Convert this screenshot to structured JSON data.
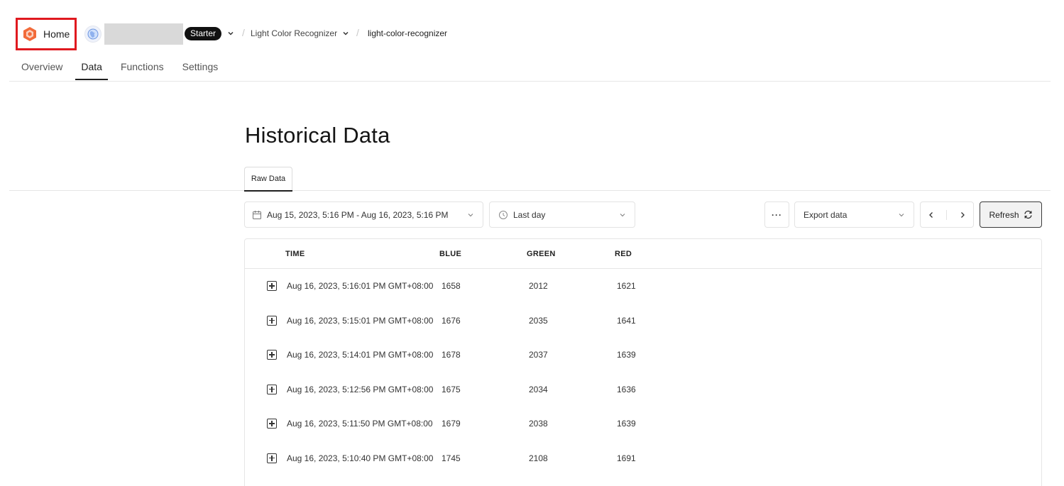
{
  "header": {
    "home_label": "Home",
    "plan_badge": "Starter",
    "app_name": "Light Color Recognizer",
    "project_name": "light-color-recognizer",
    "separator": "/"
  },
  "nav": {
    "tabs": [
      {
        "label": "Overview",
        "active": false
      },
      {
        "label": "Data",
        "active": true
      },
      {
        "label": "Functions",
        "active": false
      },
      {
        "label": "Settings",
        "active": false
      }
    ]
  },
  "main": {
    "title": "Historical Data",
    "data_tab": "Raw Data",
    "controls": {
      "date_range": "Aug 15, 2023, 5:16 PM - Aug 16, 2023, 5:16 PM",
      "time_preset": "Last day",
      "more": "···",
      "export_label": "Export data",
      "refresh_label": "Refresh"
    },
    "table": {
      "columns": [
        "TIME",
        "BLUE",
        "GREEN",
        "RED"
      ],
      "rows": [
        {
          "time": "Aug 16, 2023, 5:16:01 PM GMT+08:00",
          "blue": "1658",
          "green": "2012",
          "red": "1621"
        },
        {
          "time": "Aug 16, 2023, 5:15:01 PM GMT+08:00",
          "blue": "1676",
          "green": "2035",
          "red": "1641"
        },
        {
          "time": "Aug 16, 2023, 5:14:01 PM GMT+08:00",
          "blue": "1678",
          "green": "2037",
          "red": "1639"
        },
        {
          "time": "Aug 16, 2023, 5:12:56 PM GMT+08:00",
          "blue": "1675",
          "green": "2034",
          "red": "1636"
        },
        {
          "time": "Aug 16, 2023, 5:11:50 PM GMT+08:00",
          "blue": "1679",
          "green": "2038",
          "red": "1639"
        },
        {
          "time": "Aug 16, 2023, 5:10:40 PM GMT+08:00",
          "blue": "1745",
          "green": "2108",
          "red": "1691"
        }
      ]
    }
  },
  "icons": {
    "home_logo": "hexagon-logo-icon",
    "org_avatar": "globe-icon",
    "calendar": "calendar-icon",
    "clock": "clock-icon",
    "refresh": "refresh-icon",
    "expand": "plus-square-icon"
  },
  "colors": {
    "highlight_border": "#e0191f",
    "brand_orange": "#f26b3a",
    "badge_bg": "#111111"
  }
}
